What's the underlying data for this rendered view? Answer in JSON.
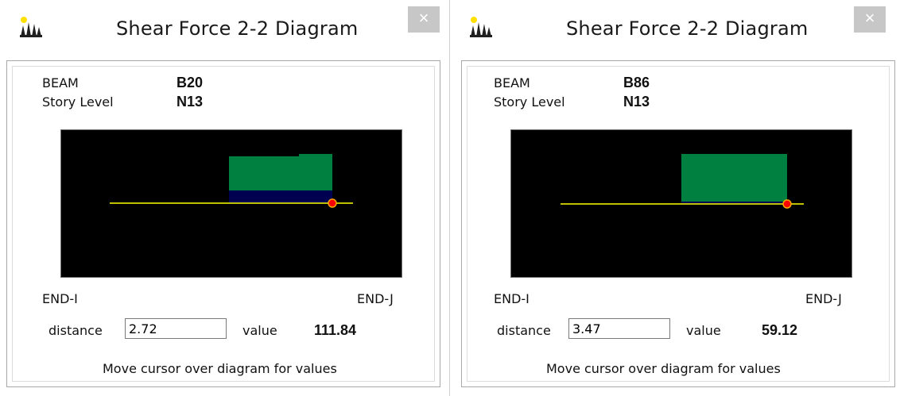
{
  "windows": [
    {
      "title": "Shear Force 2-2 Diagram",
      "close_icon": "×",
      "beam_label": "BEAM",
      "beam_value": "B20",
      "story_label": "Story Level",
      "story_value": "N13",
      "end_i": "END-I",
      "end_j": "END-J",
      "distance_label": "distance",
      "distance_value": "2.72",
      "value_label": "value",
      "value": "111.84",
      "hint": "Move cursor over diagram for values"
    },
    {
      "title": "Shear Force 2-2 Diagram",
      "close_icon": "×",
      "beam_label": "BEAM",
      "beam_value": "B86",
      "story_label": "Story Level",
      "story_value": "N13",
      "end_i": "END-I",
      "end_j": "END-J",
      "distance_label": "distance",
      "distance_value": "3.47",
      "value_label": "value",
      "value": "59.12",
      "hint": "Move cursor over diagram for values"
    }
  ],
  "colors": {
    "diagram_bg": "#000000",
    "shear_fill": "#008040",
    "base_fill": "#000050",
    "axis_line": "#ffff00",
    "cursor_marker": "#ff0000"
  },
  "icons": [
    "app-icon",
    "close-icon"
  ]
}
